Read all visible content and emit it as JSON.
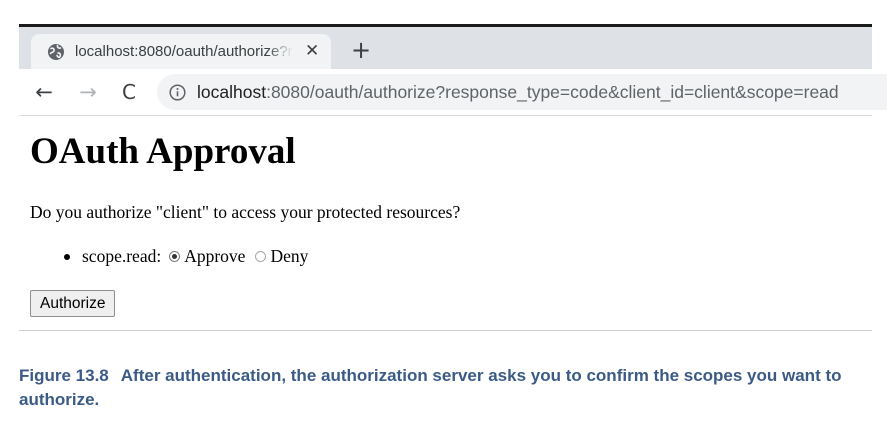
{
  "browser": {
    "tab": {
      "title": "localhost:8080/oauth/authorize?r",
      "close_glyph": "✕",
      "favicon": "globe-icon"
    },
    "new_tab_glyph": "+",
    "nav": {
      "back_glyph": "←",
      "forward_glyph": "→",
      "reload_glyph": "C"
    },
    "address": {
      "icon": "info-icon",
      "host": "localhost",
      "rest": ":8080/oauth/authorize?response_type=code&client_id=client&scope=read"
    }
  },
  "page": {
    "title": "OAuth Approval",
    "question": "Do you authorize \"client\" to access your protected resources?",
    "scopes": [
      {
        "label": "scope.read:",
        "options": [
          {
            "label": "Approve",
            "selected": true
          },
          {
            "label": "Deny",
            "selected": false
          }
        ]
      }
    ],
    "authorize_label": "Authorize"
  },
  "caption": {
    "label": "Figure 13.8",
    "text": "After authentication, the authorization server asks you to confirm the scopes you want to authorize."
  },
  "colors": {
    "caption": "#3b5b86",
    "tab_strip": "#dee1e6",
    "omnibox": "#f1f3f4"
  }
}
